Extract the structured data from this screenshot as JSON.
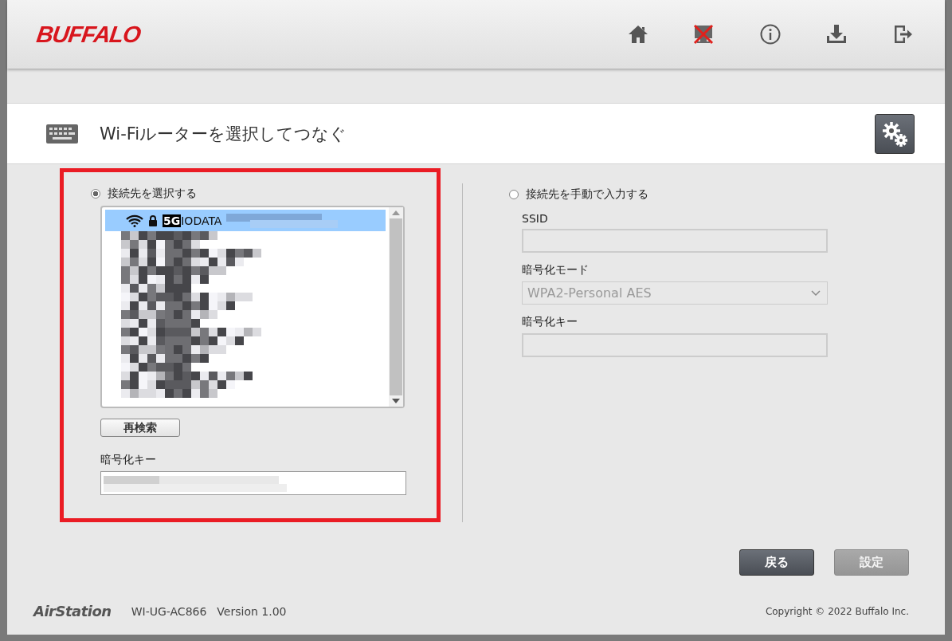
{
  "header": {
    "logo": "BUFFALO"
  },
  "page": {
    "title": "Wi-Fiルーターを選択してつなぐ"
  },
  "select_section": {
    "option": {
      "label": "接続先を選択する",
      "selected": true
    },
    "networks": [
      {
        "badge": "5G",
        "ssid": "IODATA",
        "secured": true,
        "selected": true
      }
    ],
    "rescan_button": "再検索",
    "key_label": "暗号化キー"
  },
  "manual_section": {
    "option": {
      "label": "接続先を手動で入力する",
      "selected": false
    },
    "disabled": true,
    "ssid_label": "SSID",
    "mode_label": "暗号化モード",
    "mode_value": "WPA2-Personal AES",
    "key_label": "暗号化キー"
  },
  "buttons": [
    {
      "label": "戻る",
      "disabled": false
    },
    {
      "label": "設定",
      "disabled": true
    }
  ],
  "footer": {
    "brand": "AirStation",
    "model": "WI-UG-AC866",
    "version": "Version 1.00",
    "copyright": "Copyright © 2022 Buffalo Inc."
  }
}
